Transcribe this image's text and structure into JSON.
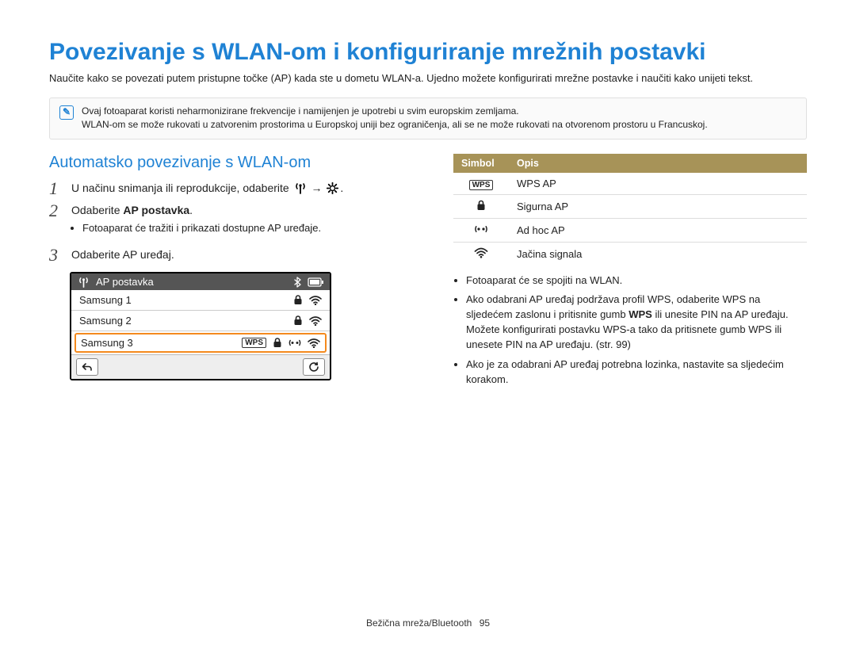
{
  "title": "Povezivanje s WLAN-om i konfiguriranje mrežnih postavki",
  "intro": "Naučite kako se povezati putem pristupne točke (AP) kada ste u dometu WLAN-a. Ujedno možete konfigurirati mrežne postavke i naučiti kako unijeti tekst.",
  "note": {
    "line1": "Ovaj fotoaparat koristi neharmonizirane frekvencije i namijenjen je upotrebi u svim europskim zemljama.",
    "line2": "WLAN-om se može rukovati u zatvorenim prostorima u Europskoj uniji bez ograničenja, ali se ne može rukovati na otvorenom prostoru u Francuskoj."
  },
  "section_title": "Automatsko povezivanje s WLAN-om",
  "steps": {
    "s1a": "U načinu snimanja ili reprodukcije, odaberite ",
    "arrow": "→",
    "s1b": ".",
    "s2a": "Odaberite ",
    "s2b": "AP postavka",
    "s2c": ".",
    "s2_sub": "Fotoaparat će tražiti i prikazati dostupne AP uređaje.",
    "s3": "Odaberite AP uređaj."
  },
  "device": {
    "title": "AP postavka",
    "rows": [
      "Samsung 1",
      "Samsung 2",
      "Samsung 3"
    ],
    "wps": "WPS"
  },
  "table": {
    "h1": "Simbol",
    "h2": "Opis",
    "rows": [
      {
        "sym": "WPS",
        "desc": "WPS AP",
        "sym_is_badge": true
      },
      {
        "sym": "lock",
        "desc": "Sigurna AP"
      },
      {
        "sym": "adhoc",
        "desc": "Ad hoc AP"
      },
      {
        "sym": "wifi",
        "desc": "Jačina signala"
      }
    ]
  },
  "right_bullets": {
    "b1": "Fotoaparat će se spojiti na WLAN.",
    "b2a": "Ako odabrani AP uređaj podržava profil WPS, odaberite WPS na sljedećem zaslonu i pritisnite gumb ",
    "b2bold": "WPS",
    "b2b": " ili unesite PIN na AP uređaju. Možete konfigurirati postavku WPS-a tako da pritisnete gumb WPS ili unesete PIN na AP uređaju. (str. 99)",
    "b3": "Ako je za odabrani AP uređaj potrebna lozinka, nastavite sa sljedećim korakom."
  },
  "footer_label": "Bežična mreža/Bluetooth",
  "footer_page": "95"
}
